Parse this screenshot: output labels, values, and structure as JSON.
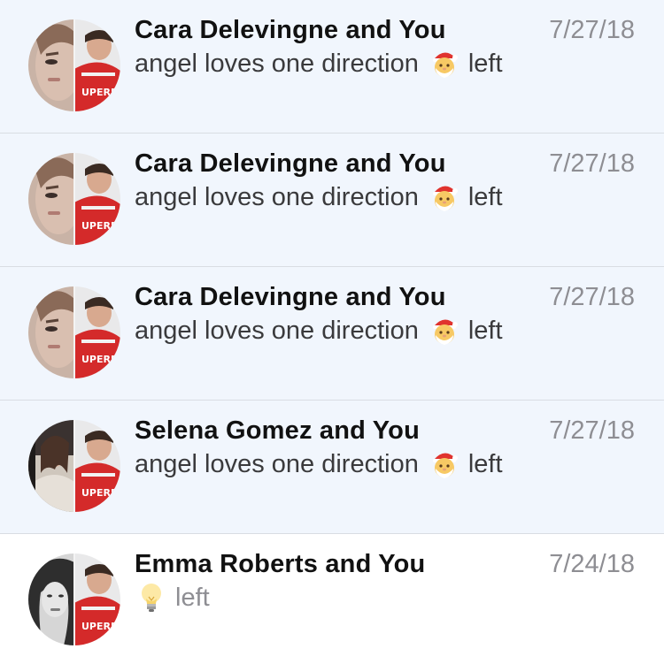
{
  "conversations": [
    {
      "title": "Cara Delevingne and You",
      "date": "7/27/18",
      "preview_prefix": "angel loves one direction",
      "preview_emoji": "santa-face-icon",
      "preview_suffix": "left",
      "unread": true,
      "avatar": "group-avatar-cara"
    },
    {
      "title": "Cara Delevingne and You",
      "date": "7/27/18",
      "preview_prefix": "angel loves one direction",
      "preview_emoji": "santa-face-icon",
      "preview_suffix": "left",
      "unread": true,
      "avatar": "group-avatar-cara"
    },
    {
      "title": "Cara Delevingne and You",
      "date": "7/27/18",
      "preview_prefix": "angel loves one direction",
      "preview_emoji": "santa-face-icon",
      "preview_suffix": "left",
      "unread": true,
      "avatar": "group-avatar-cara"
    },
    {
      "title": "Selena Gomez and You",
      "date": "7/27/18",
      "preview_prefix": "angel loves one direction",
      "preview_emoji": "santa-face-icon",
      "preview_suffix": "left",
      "unread": true,
      "avatar": "group-avatar-selena"
    },
    {
      "title": "Emma Roberts and You",
      "date": "7/24/18",
      "preview_prefix": "",
      "preview_emoji": "light-bulb-icon",
      "preview_suffix": "left",
      "unread": false,
      "avatar": "group-avatar-emma"
    }
  ],
  "colors": {
    "unread_bg": "#f1f6fd",
    "read_bg": "#ffffff",
    "divider": "#d9dde3",
    "title": "#111111",
    "date": "#8e8e93",
    "preview": "#3a3a3c"
  }
}
